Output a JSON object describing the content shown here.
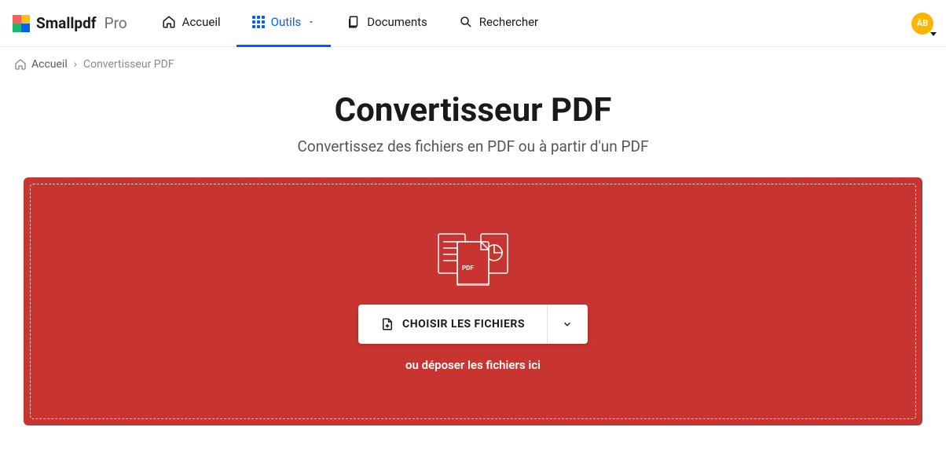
{
  "brand": {
    "name": "Smallpdf",
    "suffix": "Pro"
  },
  "nav": {
    "home": "Accueil",
    "tools": "Outils",
    "documents": "Documents",
    "search": "Rechercher"
  },
  "avatar": {
    "initials": "ÄB"
  },
  "breadcrumb": {
    "home": "Accueil",
    "current": "Convertisseur PDF"
  },
  "hero": {
    "title": "Convertisseur PDF",
    "subtitle": "Convertissez des fichiers en PDF ou à partir d'un PDF"
  },
  "dropzone": {
    "choose_label": "CHOISIR LES FICHIERS",
    "drop_hint": "ou déposer les fichiers ici",
    "pdf_badge": "PDF"
  },
  "colors": {
    "accent": "#0060ff",
    "dropzone_bg": "#c8342f",
    "avatar_bg": "#ffb400"
  }
}
